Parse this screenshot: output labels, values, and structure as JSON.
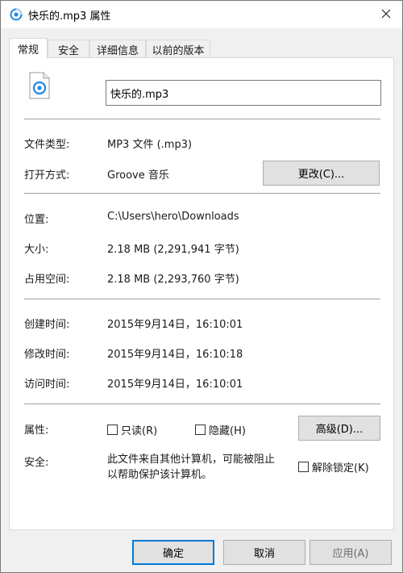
{
  "window": {
    "title": "快乐的.mp3 属性",
    "title_icon": "media-file-icon",
    "close_icon": "close-icon"
  },
  "tabs": [
    {
      "label": "常规",
      "active": true
    },
    {
      "label": "安全",
      "active": false
    },
    {
      "label": "详细信息",
      "active": false
    },
    {
      "label": "以前的版本",
      "active": false
    }
  ],
  "general": {
    "file_icon": "music-file-icon",
    "file_name": "快乐的.mp3",
    "file_type_label": "文件类型:",
    "file_type_value": "MP3 文件 (.mp3)",
    "open_with_label": "打开方式:",
    "open_with_value": "Groove 音乐",
    "change_button": "更改(C)...",
    "location_label": "位置:",
    "location_value": "C:\\Users\\hero\\Downloads",
    "size_label": "大小:",
    "size_value": "2.18 MB (2,291,941 字节)",
    "size_on_disk_label": "占用空间:",
    "size_on_disk_value": "2.18 MB (2,293,760 字节)",
    "created_label": "创建时间:",
    "created_value": "2015年9月14日，16:10:01",
    "modified_label": "修改时间:",
    "modified_value": "2015年9月14日，16:10:18",
    "accessed_label": "访问时间:",
    "accessed_value": "2015年9月14日，16:10:01",
    "attributes_label": "属性:",
    "readonly_label": "只读(R)",
    "hidden_label": "隐藏(H)",
    "advanced_button": "高级(D)...",
    "security_label": "安全:",
    "security_text_line1": "此文件来自其他计算机，可能被阻止",
    "security_text_line2": "以帮助保护该计算机。",
    "unblock_label": "解除锁定(K)"
  },
  "footer": {
    "ok_button": "确定",
    "cancel_button": "取消",
    "apply_button": "应用(A)"
  },
  "colors": {
    "accent": "#0078d7",
    "icon_blue": "#1e88e5"
  }
}
